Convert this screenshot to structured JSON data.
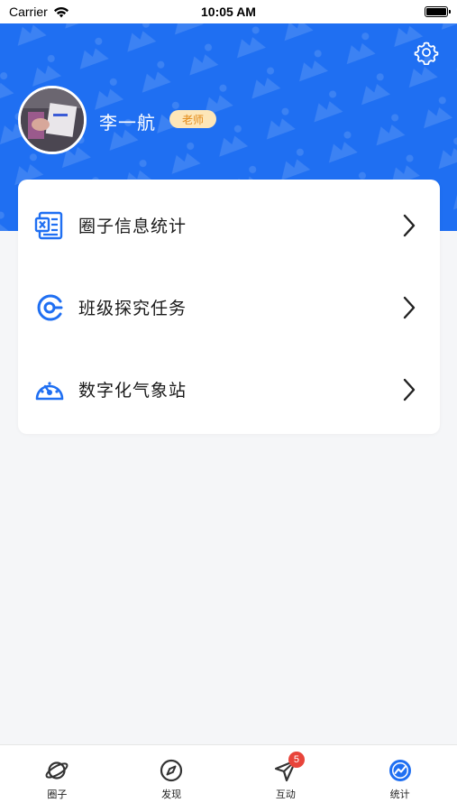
{
  "status_bar": {
    "carrier": "Carrier",
    "time": "10:05 AM"
  },
  "profile": {
    "name": "李一航",
    "role": "老师"
  },
  "menu": {
    "items": [
      {
        "label": "圈子信息统计",
        "icon": "spreadsheet-icon"
      },
      {
        "label": "班级探究任务",
        "icon": "task-icon"
      },
      {
        "label": "数字化气象站",
        "icon": "gauge-icon"
      }
    ]
  },
  "tabbar": {
    "tabs": [
      {
        "label": "圈子",
        "icon": "planet-icon"
      },
      {
        "label": "发现",
        "icon": "compass-icon"
      },
      {
        "label": "互动",
        "icon": "send-icon",
        "badge": "5"
      },
      {
        "label": "统计",
        "icon": "stats-icon",
        "active": true
      }
    ]
  },
  "colors": {
    "brand_blue": "#1f6ff2",
    "badge_bg": "#fde6b8",
    "badge_text": "#e28a18",
    "notification_red": "#e8443a",
    "background": "#f5f6f8"
  }
}
